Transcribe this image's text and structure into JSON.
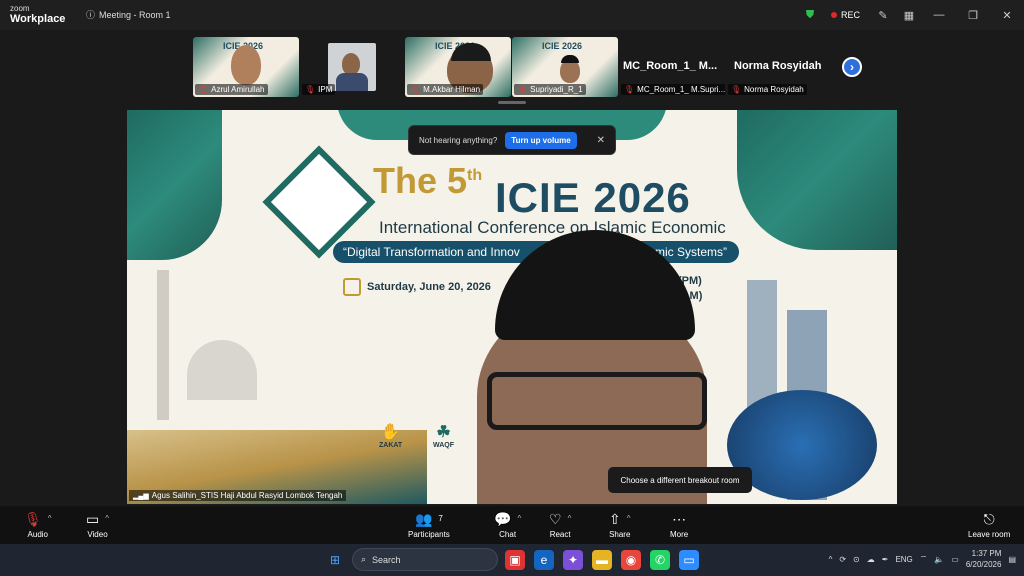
{
  "app": {
    "logo_top": "zoom",
    "logo_bottom": "Workplace",
    "meeting_title": "Meeting - Room 1",
    "rec_label": "REC"
  },
  "strip": {
    "tiles": [
      {
        "name": "Azrul Amirullah"
      },
      {
        "name": "IPM"
      },
      {
        "name": "M.Akbar Hilman"
      },
      {
        "name": "Supriyadi_R_1"
      },
      {
        "name": "MC_Room_1_ M.Supri...",
        "big": "MC_Room_1_  M..."
      },
      {
        "name": "Norma Rosyidah",
        "big": "Norma Rosyidah"
      }
    ],
    "mini_poster_title": "ICIE 2026"
  },
  "poster": {
    "the": "The 5",
    "th": "th",
    "icie": "ICIE 2026",
    "conference": "International Conference on Islamic Economic",
    "theme": "“Digital Transformation and Innov",
    "theme_end": "onomic Systems”",
    "date": "Saturday, June 20, 2026",
    "time1": "me (PM)",
    "time2": "me (AM)",
    "zakat": "ZAKAT",
    "waqf": "WAQF"
  },
  "notice": {
    "text": "Not hearing anything?",
    "button": "Turn up volume"
  },
  "main_speaker": "Agus Salihin_STIS Haji Abdul Rasyid Lombok Tengah",
  "tooltip": "Choose a different breakout room",
  "toolbar": {
    "audio": "Audio",
    "video": "Video",
    "participants": "Participants",
    "participants_count": "7",
    "chat": "Chat",
    "react": "React",
    "share": "Share",
    "more": "More",
    "leave": "Leave room"
  },
  "taskbar": {
    "search": "Search",
    "lang": "ENG",
    "time": "1:37 PM",
    "date": "6/20/2026"
  }
}
